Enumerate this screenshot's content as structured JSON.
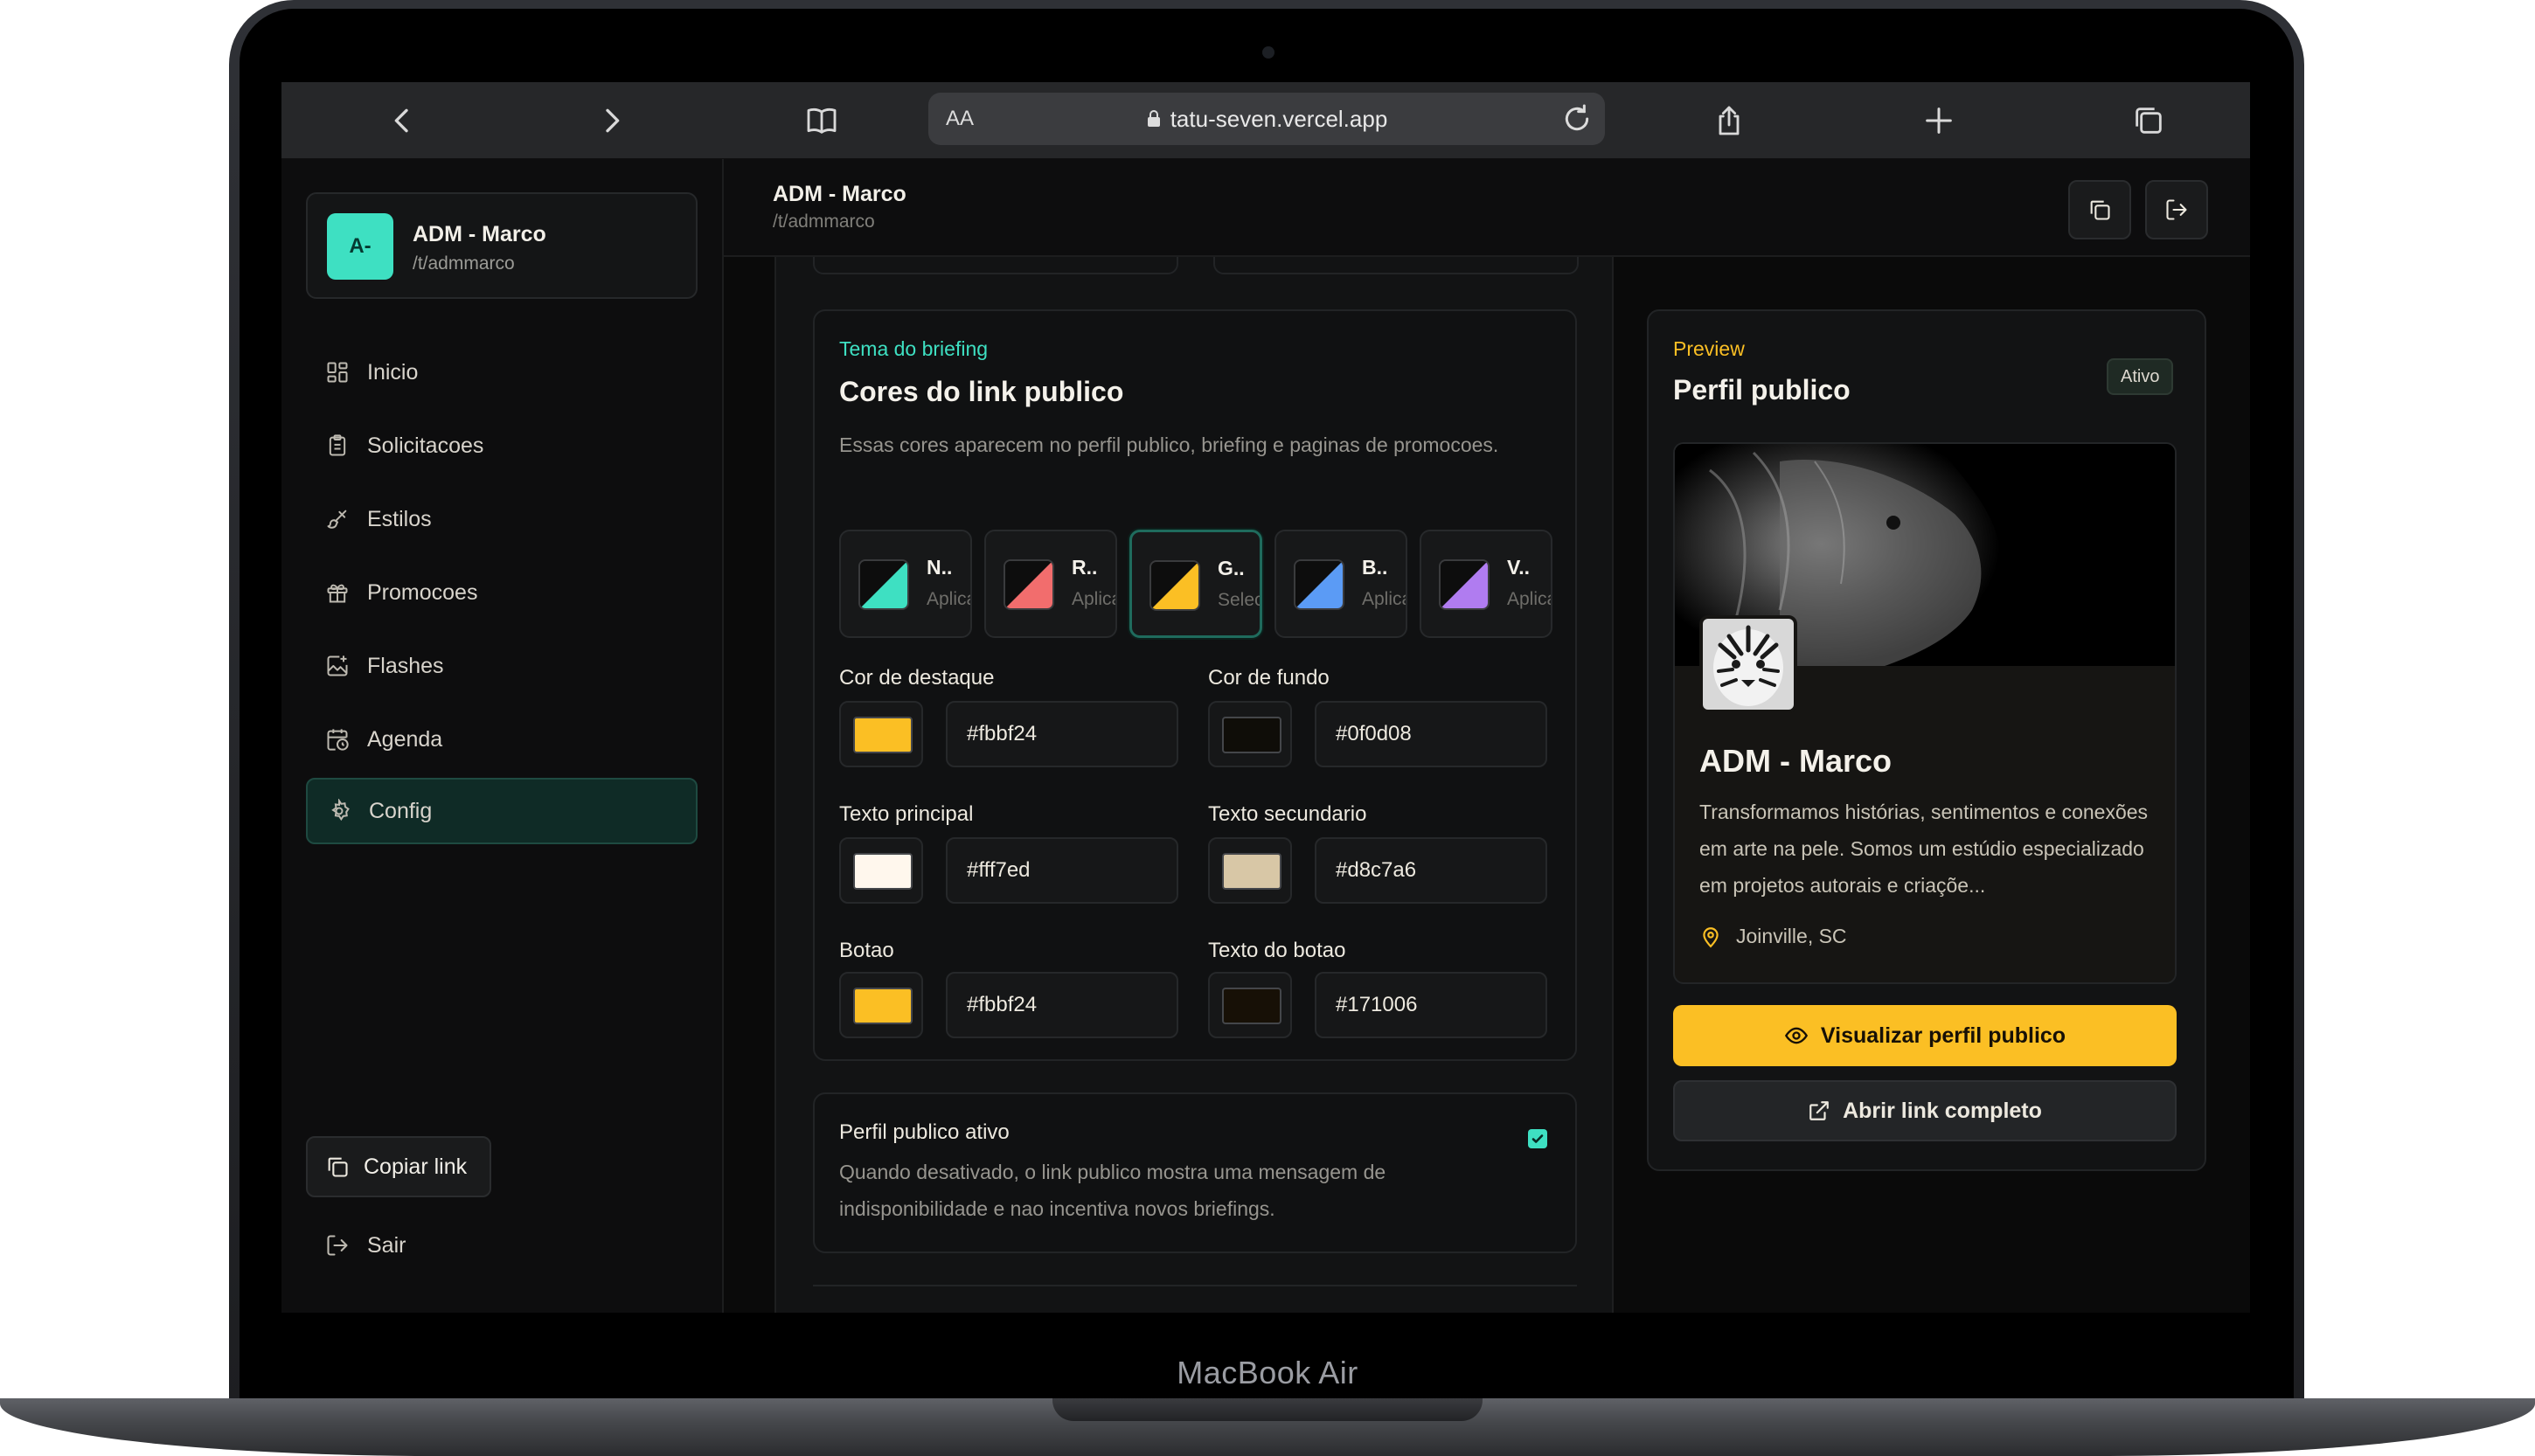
{
  "device": {
    "label": "MacBook Air"
  },
  "browser": {
    "reader_label": "AA",
    "url": "tatu-seven.vercel.app"
  },
  "sidebar": {
    "brand": {
      "initials": "A-",
      "name": "ADM - Marco",
      "slug": "/t/admmarco"
    },
    "items": [
      {
        "label": "Inicio",
        "icon": "grid-icon"
      },
      {
        "label": "Solicitacoes",
        "icon": "clipboard-icon"
      },
      {
        "label": "Estilos",
        "icon": "brush-icon"
      },
      {
        "label": "Promocoes",
        "icon": "gift-icon"
      },
      {
        "label": "Flashes",
        "icon": "image-spark-icon"
      },
      {
        "label": "Agenda",
        "icon": "calendar-clock-icon"
      },
      {
        "label": "Config",
        "icon": "gear-icon",
        "active": true
      }
    ],
    "copy_link": "Copiar link",
    "logout": "Sair"
  },
  "header": {
    "title": "ADM - Marco",
    "slug": "/t/admmarco"
  },
  "theme_card": {
    "eyebrow": "Tema do briefing",
    "title": "Cores do link publico",
    "description": "Essas cores aparecem no perfil publico, briefing e paginas de promocoes.",
    "presets": [
      {
        "name": "N..",
        "action": "Aplicar",
        "accent": "#3ee0c2"
      },
      {
        "name": "R..",
        "action": "Aplicar",
        "accent": "#f26d6d"
      },
      {
        "name": "G..",
        "action": "Selecionado",
        "accent": "#fbbf24",
        "selected": true
      },
      {
        "name": "B..",
        "action": "Aplicar",
        "accent": "#5b9bf5"
      },
      {
        "name": "V..",
        "action": "Aplicar",
        "accent": "#b07cf0"
      }
    ],
    "fields": [
      {
        "label": "Cor de destaque",
        "value": "#fbbf24"
      },
      {
        "label": "Cor de fundo",
        "value": "#0f0d08"
      },
      {
        "label": "Texto principal",
        "value": "#fff7ed"
      },
      {
        "label": "Texto secundario",
        "value": "#d8c7a6"
      },
      {
        "label": "Botao",
        "value": "#fbbf24"
      },
      {
        "label": "Texto do botao",
        "value": "#171006"
      }
    ]
  },
  "active_card": {
    "title": "Perfil publico ativo",
    "description": "Quando desativado, o link publico mostra uma mensagem de indisponibilidade e nao incentiva novos briefings.",
    "checked": true
  },
  "preview": {
    "eyebrow": "Preview",
    "title": "Perfil publico",
    "badge": "Ativo",
    "profile": {
      "name": "ADM - Marco",
      "bio": "Transformamos histórias, sentimentos e conexões em arte na pele. Somos um estúdio especializado em projetos autorais e criaçõe...",
      "location": "Joinville, SC"
    },
    "primary_button": "Visualizar perfil publico",
    "secondary_button": "Abrir link completo"
  },
  "colors": {
    "accent": "#fbbf24",
    "teal": "#3ee0c2",
    "background": "#0a0a0a"
  }
}
